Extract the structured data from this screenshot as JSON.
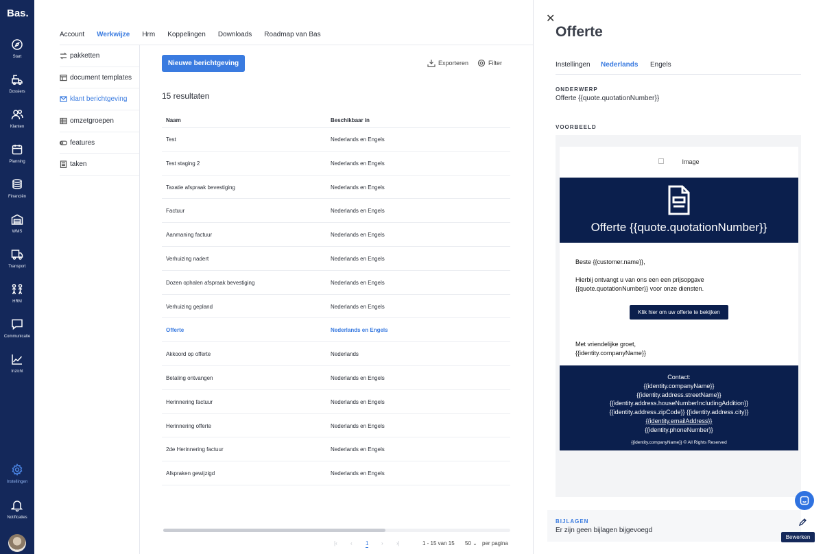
{
  "app": {
    "logo": "Bas."
  },
  "nav": {
    "items": [
      {
        "label": "Start",
        "icon": "compass-icon"
      },
      {
        "label": "Dossiers",
        "icon": "dossiers-icon"
      },
      {
        "label": "Klanten",
        "icon": "users-icon"
      },
      {
        "label": "Planning",
        "icon": "calendar-icon"
      },
      {
        "label": "Financiën",
        "icon": "coins-icon"
      },
      {
        "label": "WMS",
        "icon": "warehouse-icon"
      },
      {
        "label": "Transport",
        "icon": "truck-icon"
      },
      {
        "label": "HRM",
        "icon": "team-icon"
      },
      {
        "label": "Communicatie",
        "icon": "chat-bubble-icon"
      },
      {
        "label": "Inzicht",
        "icon": "line-chart-icon"
      }
    ],
    "settings_label": "Instellingen",
    "notifications_label": "Notificaties"
  },
  "toptabs": [
    "Account",
    "Werkwijze",
    "Hrm",
    "Koppelingen",
    "Downloads",
    "Roadmap van Bas"
  ],
  "toptabs_active": "Werkwijze",
  "submenu": [
    {
      "label": "pakketten",
      "icon": "arrows-icon"
    },
    {
      "label": "document templates",
      "icon": "table-icon"
    },
    {
      "label": "klant berichtgeving",
      "icon": "mail-icon"
    },
    {
      "label": "omzetgroepen",
      "icon": "grid-icon"
    },
    {
      "label": "features",
      "icon": "toggle-icon"
    },
    {
      "label": "taken",
      "icon": "clipboard-icon"
    }
  ],
  "list": {
    "new_button": "Nieuwe berichtgeving",
    "export_label": "Exporteren",
    "filter_label": "Filter",
    "results": "15 resultaten",
    "columns": [
      "Naam",
      "Beschikbaar in"
    ],
    "rows": [
      [
        "Test",
        "Nederlands en Engels"
      ],
      [
        "Test staging 2",
        "Nederlands en Engels"
      ],
      [
        "Taxatie afspraak bevestiging",
        "Nederlands en Engels"
      ],
      [
        "Factuur",
        "Nederlands en Engels"
      ],
      [
        "Aanmaning factuur",
        "Nederlands en Engels"
      ],
      [
        "Verhuizing nadert",
        "Nederlands en Engels"
      ],
      [
        "Dozen ophalen afspraak bevestiging",
        "Nederlands en Engels"
      ],
      [
        "Verhuizing gepland",
        "Nederlands en Engels"
      ],
      [
        "Offerte",
        "Nederlands en Engels"
      ],
      [
        "Akkoord op offerte",
        "Nederlands"
      ],
      [
        "Betaling ontvangen",
        "Nederlands en Engels"
      ],
      [
        "Herinnering factuur",
        "Nederlands en Engels"
      ],
      [
        "Herinnering offerte",
        "Nederlands en Engels"
      ],
      [
        "2de Herinnering factuur",
        "Nederlands en Engels"
      ],
      [
        "Afspraken gewijzigd",
        "Nederlands en Engels"
      ]
    ],
    "selected_row": "Offerte",
    "pagination": {
      "current_page": "1",
      "range": "1 - 15 van 15",
      "page_size": "50",
      "per_page_label": "per pagina"
    }
  },
  "drawer": {
    "title": "Offerte",
    "tabs": [
      "Instellingen",
      "Nederlands",
      "Engels"
    ],
    "active_tab": "Nederlands",
    "subject_caption": "ONDERWERP",
    "subject": "Offerte {{quote.quotationNumber}}",
    "preview_caption": "VOORBEELD",
    "email": {
      "image_alt": "Image",
      "header_title": "Offerte {{quote.quotationNumber}}",
      "greeting": "Beste {{customer.name}},",
      "body_line1": "Hierbij ontvangt u van ons een een prijsopgave",
      "body_line2": "{{quote.quotationNumber}} voor onze diensten.",
      "button": "Klik hier om uw offerte te bekijken",
      "closing1": "Met vriendelijke groet,",
      "closing2": "{{identity.companyName}}",
      "footer": {
        "contact": "Contact:",
        "line1": "{{identity.companyName}}",
        "line2": "{{identity.address.streetName}}",
        "line3": "{{identity.address.houseNumberIncludingAddition}}",
        "line4": "{{identity.address.zipCode}} {{identity.address.city}}",
        "line5": "{{identity.emailAddress}}",
        "line6": "{{identity.phoneNumber}}",
        "rights": "{{identity.companyName}} ©  All Rights Reserved"
      }
    },
    "attachments_caption": "BIJLAGEN",
    "attachments_text": "Er zijn geen bijlagen bijgevoegd",
    "edit_button": "Bewerken"
  },
  "colors": {
    "nav_bg": "#14285a",
    "accent": "#3a7be0",
    "email_dark": "#0b1f4d"
  }
}
